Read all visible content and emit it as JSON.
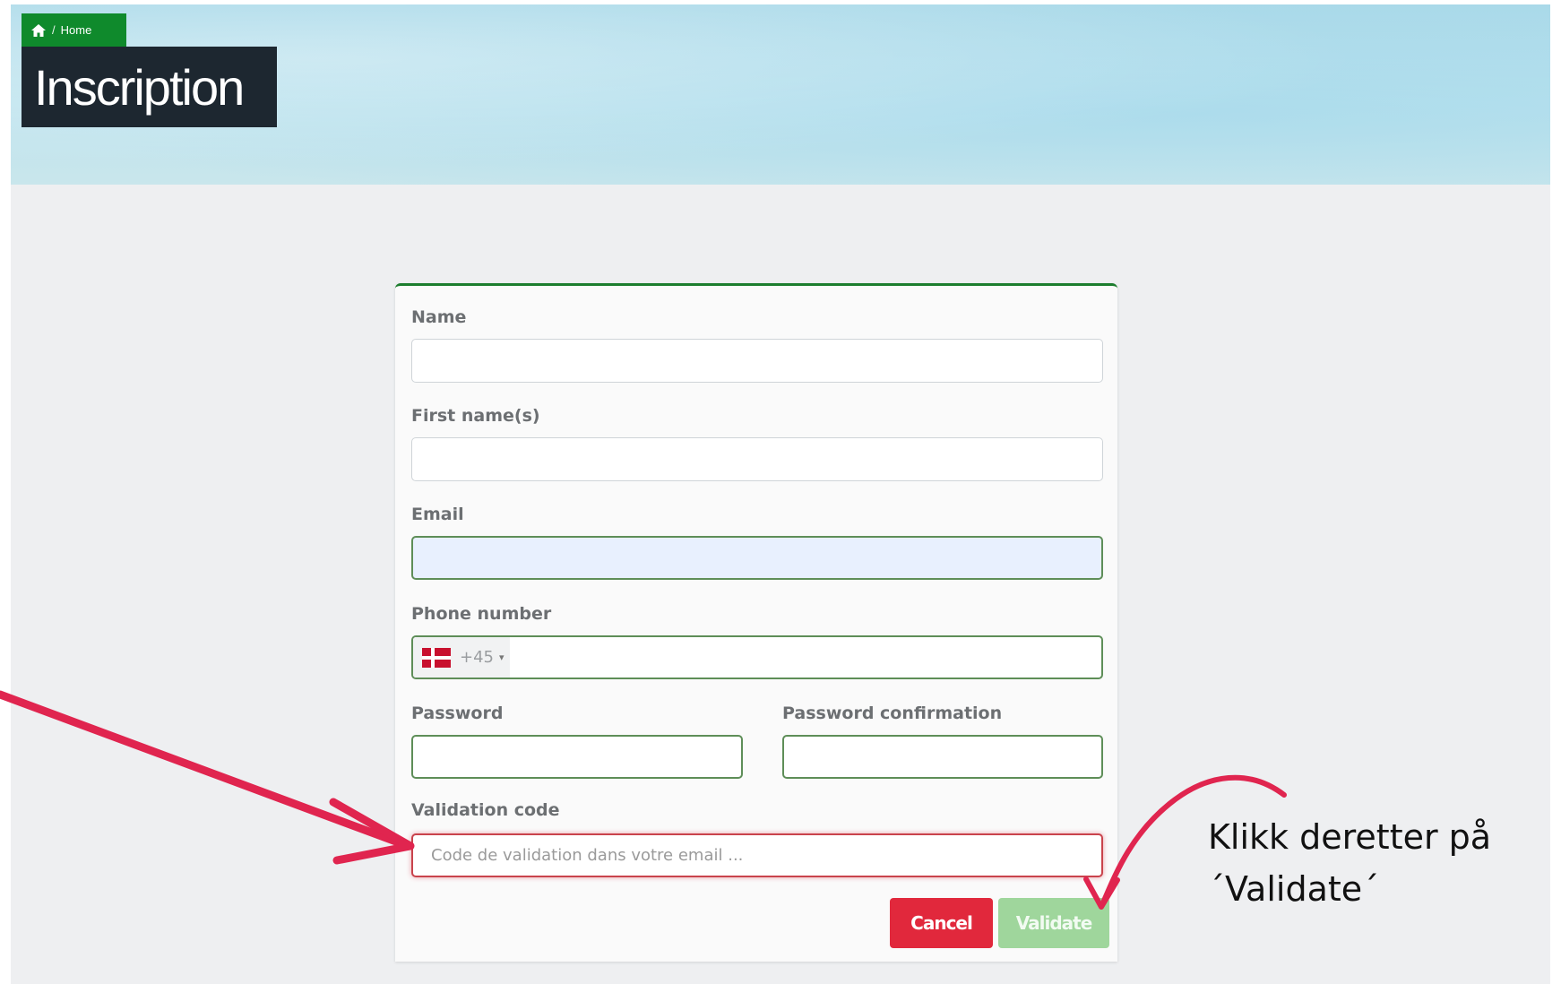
{
  "breadcrumb": {
    "home_label": "Home",
    "separator": "/"
  },
  "page": {
    "title": "Inscription"
  },
  "form": {
    "name_label": "Name",
    "first_name_label": "First name(s)",
    "email_label": "Email",
    "phone_label": "Phone number",
    "phone_country_code": "+45",
    "phone_country": "Denmark",
    "password_label": "Password",
    "password_confirmation_label": "Password confirmation",
    "validation_code_label": "Validation code",
    "validation_code_placeholder": "Code de validation dans votre email ...",
    "cancel_label": "Cancel",
    "validate_label": "Validate"
  },
  "annotation": {
    "line1": "Klikk deretter på",
    "line2": "´Validate´",
    "arrow_color": "#e0254f"
  },
  "colors": {
    "brand_green": "#0f8a2c",
    "title_bg": "#1d2730",
    "cancel": "#e1283c",
    "validate": "#9fd69c"
  },
  "icons": {
    "home": "home-icon",
    "flag": "denmark-flag-icon",
    "caret": "caret-down-icon"
  }
}
